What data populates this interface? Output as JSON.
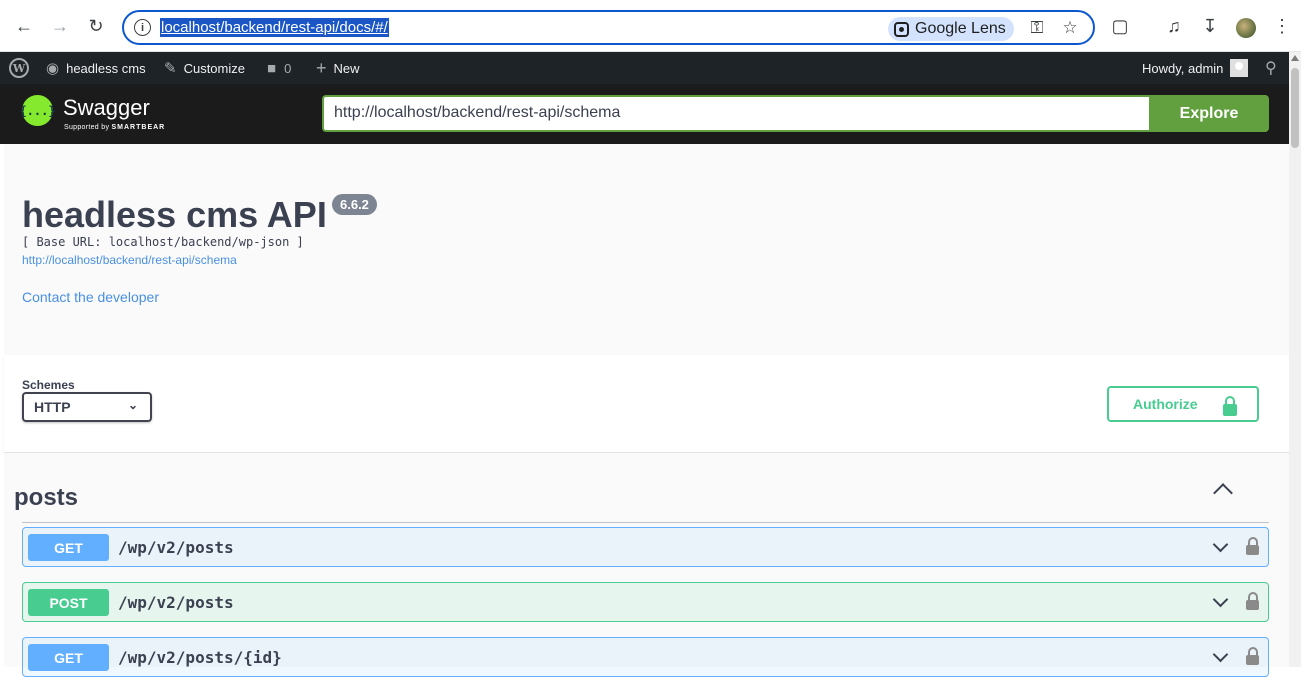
{
  "browser": {
    "url": "localhost/backend/rest-api/docs/#/",
    "lens_label": "Google Lens"
  },
  "wp_admin_bar": {
    "site_name": "headless cms",
    "customize": "Customize",
    "comments_count": "0",
    "new": "New",
    "greeting": "Howdy, admin"
  },
  "swagger": {
    "logo_text": "{...}",
    "brand": "Swagger",
    "supported_by": "Supported by",
    "smartbear": "SMARTBEAR",
    "explore_url": "http://localhost/backend/rest-api/schema",
    "explore_label": "Explore"
  },
  "info": {
    "title": "headless cms API",
    "version": "6.6.2",
    "base_url": "[ Base URL: localhost/backend/wp-json ]",
    "schema_link": "http://localhost/backend/rest-api/schema",
    "contact": "Contact the developer"
  },
  "schemes": {
    "label": "Schemes",
    "selected": "HTTP",
    "authorize_label": "Authorize"
  },
  "operations": {
    "tag": "posts",
    "items": [
      {
        "method": "GET",
        "path": "/wp/v2/posts"
      },
      {
        "method": "POST",
        "path": "/wp/v2/posts"
      },
      {
        "method": "GET",
        "path": "/wp/v2/posts/{id}"
      }
    ]
  },
  "colors": {
    "get": "#61affe",
    "post": "#49cc90",
    "swagger_green": "#62a03f",
    "wp_bar": "#1d2327"
  }
}
